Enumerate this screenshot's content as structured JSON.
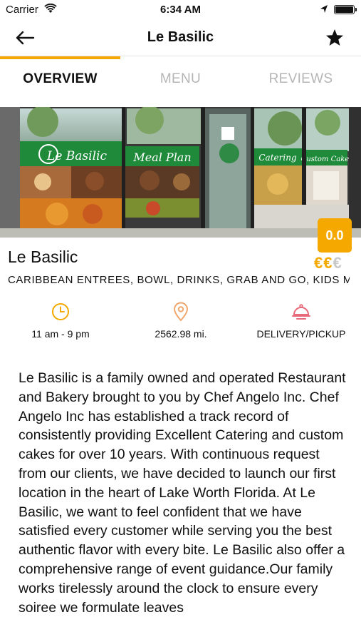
{
  "status_bar": {
    "carrier": "Carrier",
    "time": "6:34 AM"
  },
  "nav": {
    "title": "Le Basilic",
    "back_icon": "arrow-left-icon",
    "favorite_icon": "star-icon"
  },
  "tabs": [
    {
      "label": "OVERVIEW",
      "active": true
    },
    {
      "label": "MENU",
      "active": false
    },
    {
      "label": "REVIEWS",
      "active": false
    }
  ],
  "hero": {
    "signs": [
      "Le Basilic",
      "Meal Plan",
      "Catering",
      "Custom Cakes"
    ]
  },
  "restaurant": {
    "name": "Le Basilic",
    "categories": "CARIBBEAN ENTREES, BOWL, DRINKS, GRAB AND GO, KIDS M...",
    "rating": "0.0",
    "price_level": 2,
    "price_max": 3,
    "price_symbol": "€"
  },
  "info": {
    "hours": {
      "label": "11 am - 9 pm",
      "icon": "clock-icon"
    },
    "distance": {
      "label": "2562.98 mi.",
      "icon": "location-pin-icon"
    },
    "service": {
      "label": "DELIVERY/PICKUP",
      "icon": "food-cloche-icon"
    }
  },
  "description": "Le Basilic is a family owned and operated Restaurant and Bakery brought to you by Chef Angelo Inc. Chef Angelo Inc has established a track record of consistently providing Excellent Catering and custom cakes for over 10 years. With continuous request from our clients, we have decided to launch our first location in the heart of Lake Worth Florida. At Le Basilic, we want to feel confident that we have satisfied every customer while serving you the best authentic flavor with every bite. Le Basilic also offer a comprehensive range of event guidance.Our family works tirelessly around the clock to ensure every soiree we formulate leaves",
  "colors": {
    "accent": "#f5a800",
    "inactive_tab": "#b5b5b5",
    "hours_icon": "#f5a800",
    "distance_icon": "#f0a870",
    "service_icon": "#e86a7a",
    "sign_green": "#1e8a3a"
  }
}
